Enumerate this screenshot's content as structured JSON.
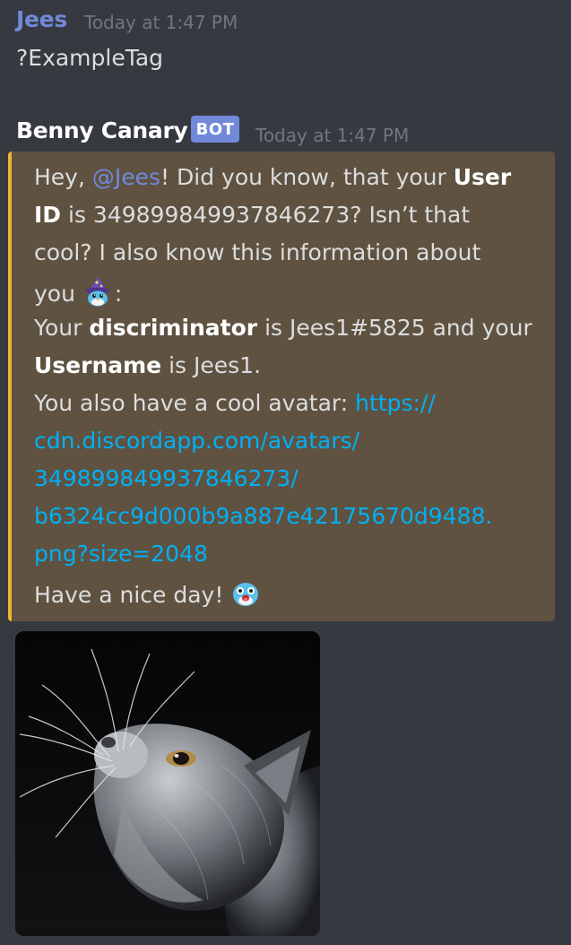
{
  "message1": {
    "author": "Jees",
    "timestamp": "Today at 1:47 PM",
    "content": "?ExampleTag"
  },
  "message2": {
    "author": "Benny Canary",
    "bot_tag": "BOT",
    "timestamp": "Today at 1:47 PM",
    "embed": {
      "line1": {
        "t1": "Hey, ",
        "mention": "@Jees",
        "t2": "! Did you know, that your ",
        "b1": "User"
      },
      "line2": {
        "b1": "ID",
        "t1": " is 349899849937846273? Isn’t that"
      },
      "line3": {
        "t1": "cool? I also know this information about"
      },
      "line4": {
        "t1": "you ",
        "t2": ":"
      },
      "line5": {
        "t1": "Your ",
        "b1": "discriminator",
        "t2": " is Jees1#5825 and your"
      },
      "line6": {
        "b1": "Username",
        "t1": " is Jees1."
      },
      "line7": {
        "t1": "You also have a cool avatar: ",
        "link": "https://"
      },
      "line8": {
        "link": "cdn.discordapp.com/avatars/"
      },
      "line9": {
        "link": "349899849937846273/"
      },
      "line10": {
        "link": "b6324cc9d000b9a887e42175670d9488."
      },
      "line11": {
        "link": "png?size=2048"
      },
      "line12": {
        "t1": "Have a nice day! "
      }
    },
    "attachment": {
      "icon": "cat-photo"
    }
  },
  "colors": {
    "background": "#36393f",
    "embed_background": "#5f5241",
    "embed_border": "#f0b232",
    "mention": "#7289da",
    "link": "#00b0f4",
    "bot_tag": "#7289da"
  }
}
